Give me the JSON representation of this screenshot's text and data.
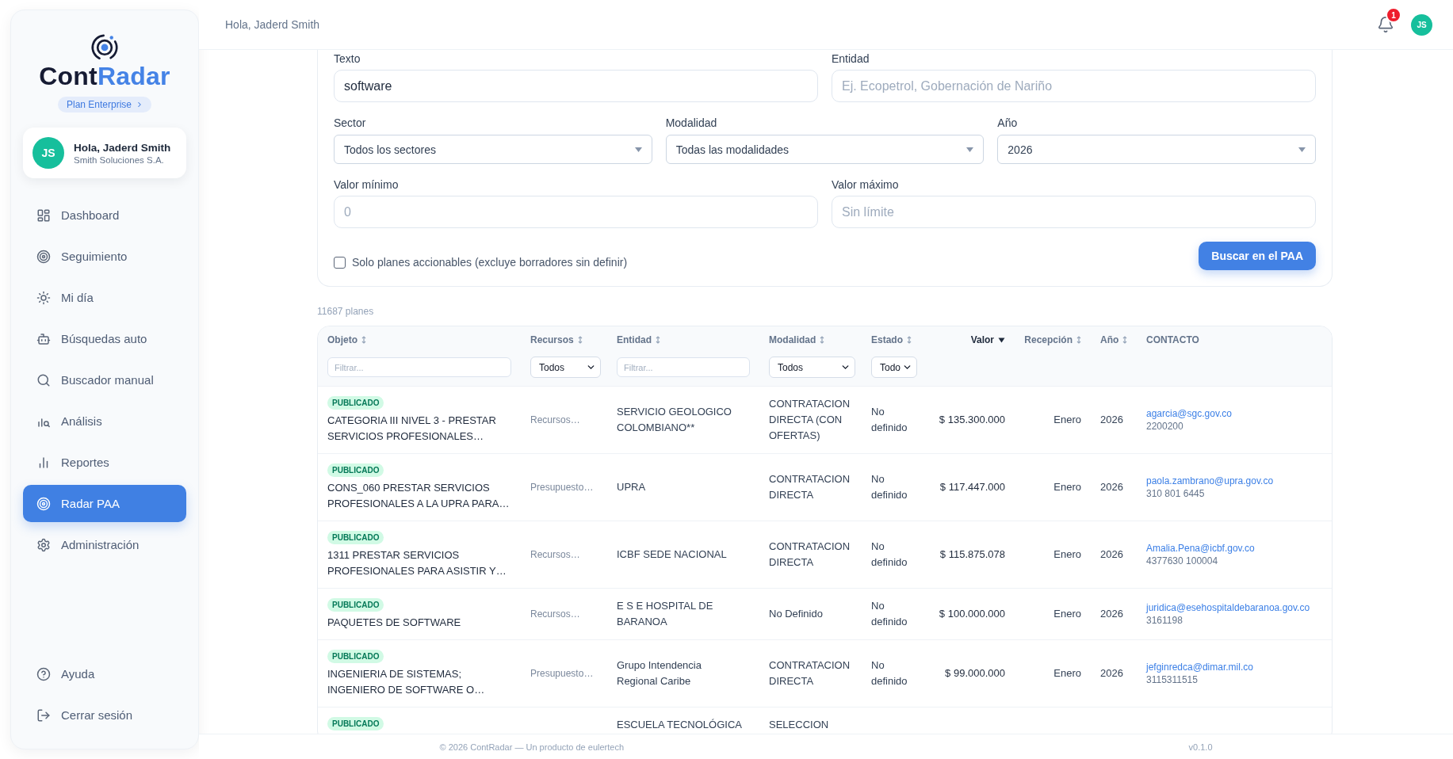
{
  "sidebar": {
    "brand": {
      "wordmark_start": "Cont",
      "wordmark_accent": "Radar"
    },
    "plan": "Plan Enterprise",
    "user": {
      "initials": "JS",
      "name": "Hola, Jaderd Smith",
      "company": "Smith Soluciones S.A."
    },
    "nav": [
      {
        "label": "Dashboard",
        "selected": false
      },
      {
        "label": "Seguimiento",
        "selected": false
      },
      {
        "label": "Mi día",
        "selected": false
      },
      {
        "label": "Búsquedas auto",
        "selected": false
      },
      {
        "label": "Buscador manual",
        "selected": false
      },
      {
        "label": "Análisis",
        "selected": false
      },
      {
        "label": "Reportes",
        "selected": false
      },
      {
        "label": "Radar PAA",
        "selected": true
      },
      {
        "label": "Administración",
        "selected": false
      }
    ],
    "bottom_nav": [
      {
        "label": "Ayuda"
      },
      {
        "label": "Cerrar sesión"
      }
    ]
  },
  "header": {
    "greeting": "Hola, Jaderd Smith",
    "notification_count": "1",
    "avatar_initials": "JS"
  },
  "search_form": {
    "rows": [
      {
        "fields": [
          {
            "kind": "input",
            "label": "Texto",
            "value": "software"
          },
          {
            "kind": "input",
            "label": "Entidad",
            "placeholder": "Ej. Ecopetrol, Gobernación de Nariño"
          }
        ]
      },
      {
        "fields": [
          {
            "kind": "select",
            "label": "Sector",
            "value": "Todos los sectores"
          },
          {
            "kind": "select",
            "label": "Modalidad",
            "value": "Todas las modalidades"
          },
          {
            "kind": "select",
            "label": "Año",
            "value": "2026"
          }
        ]
      },
      {
        "fields": [
          {
            "kind": "input",
            "label": "Valor mínimo",
            "placeholder": "0"
          },
          {
            "kind": "input",
            "label": "Valor máximo",
            "placeholder": "Sin límite"
          }
        ]
      }
    ],
    "checkbox": {
      "label": "Solo planes accionables (excluye borradores sin definir)",
      "checked": false
    },
    "submit": "Buscar en el PAA"
  },
  "result_count": "11687 planes",
  "table": {
    "columns": [
      {
        "label": "Objeto",
        "sortable": true,
        "sorted": false,
        "filter": {
          "kind": "text",
          "placeholder": "Filtrar..."
        }
      },
      {
        "label": "Recursos",
        "sortable": true,
        "sorted": false,
        "filter": {
          "kind": "select",
          "value": "Todos"
        }
      },
      {
        "label": "Entidad",
        "sortable": true,
        "sorted": false,
        "filter": {
          "kind": "text",
          "placeholder": "Filtrar..."
        }
      },
      {
        "label": "Modalidad",
        "sortable": true,
        "sorted": false,
        "filter": {
          "kind": "select",
          "value": "Todos"
        }
      },
      {
        "label": "Estado",
        "sortable": true,
        "sorted": false,
        "filter": {
          "kind": "select",
          "value": "Todo"
        }
      },
      {
        "label": "Valor",
        "sortable": true,
        "sorted": true
      },
      {
        "label": "Recepción",
        "sortable": true,
        "sorted": false
      },
      {
        "label": "Año",
        "sortable": true,
        "sorted": false
      },
      {
        "label": "CONTACTO",
        "sortable": false,
        "sorted": false
      }
    ],
    "rows": [
      {
        "status": "PUBLICADO",
        "objeto": "CATEGORIA III NIVEL 3 - PRESTAR SERVICIOS PROFESIONALES…",
        "recursos": "Recursos…",
        "entidad": "SERVICIO GEOLOGICO COLOMBIANO**",
        "modalidad": "CONTRATACION DIRECTA (CON OFERTAS)",
        "estado": "No definido",
        "valor": "$ 135.300.000",
        "recepcion": "Enero",
        "anio": "2026",
        "email": "agarcia@sgc.gov.co",
        "phone": "2200200"
      },
      {
        "status": "PUBLICADO",
        "objeto": "CONS_060 PRESTAR SERVICIOS PROFESIONALES A LA UPRA PARA…",
        "recursos": "Presupuesto…",
        "entidad": "UPRA",
        "modalidad": "CONTRATACION DIRECTA",
        "estado": "No definido",
        "valor": "$ 117.447.000",
        "recepcion": "Enero",
        "anio": "2026",
        "email": "paola.zambrano@upra.gov.co",
        "phone": "310 801 6445"
      },
      {
        "status": "PUBLICADO",
        "objeto": "1311 PRESTAR SERVICIOS PROFESIONALES PARA ASISTIR Y…",
        "recursos": "Recursos…",
        "entidad": "ICBF SEDE NACIONAL",
        "modalidad": "CONTRATACION DIRECTA",
        "estado": "No definido",
        "valor": "$ 115.875.078",
        "recepcion": "Enero",
        "anio": "2026",
        "email": "Amalia.Pena@icbf.gov.co",
        "phone": "4377630 100004"
      },
      {
        "status": "PUBLICADO",
        "objeto": "PAQUETES DE SOFTWARE",
        "recursos": "Recursos…",
        "entidad": "E S E HOSPITAL DE BARANOA",
        "modalidad": "No Definido",
        "estado": "No definido",
        "valor": "$ 100.000.000",
        "recepcion": "Enero",
        "anio": "2026",
        "email": "juridica@esehospitaldebaranoa.gov.co",
        "phone": "3161198"
      },
      {
        "status": "PUBLICADO",
        "objeto": "INGENIERIA DE SISTEMAS; INGENIERO DE SOFTWARE O…",
        "recursos": "Presupuesto…",
        "entidad": "Grupo Intendencia Regional Caribe",
        "modalidad": "CONTRATACION DIRECTA",
        "estado": "No definido",
        "valor": "$ 99.000.000",
        "recepcion": "Enero",
        "anio": "2026",
        "email": "jefginredca@dimar.mil.co",
        "phone": "3115311515"
      },
      {
        "status": "PUBLICADO",
        "entidad": "ESCUELA TECNOLÓGICA",
        "modalidad": "SELECCION"
      }
    ]
  },
  "footer": {
    "copyright": "© 2026 ContRadar — Un producto de eulertech",
    "version": "v0.1.0"
  }
}
